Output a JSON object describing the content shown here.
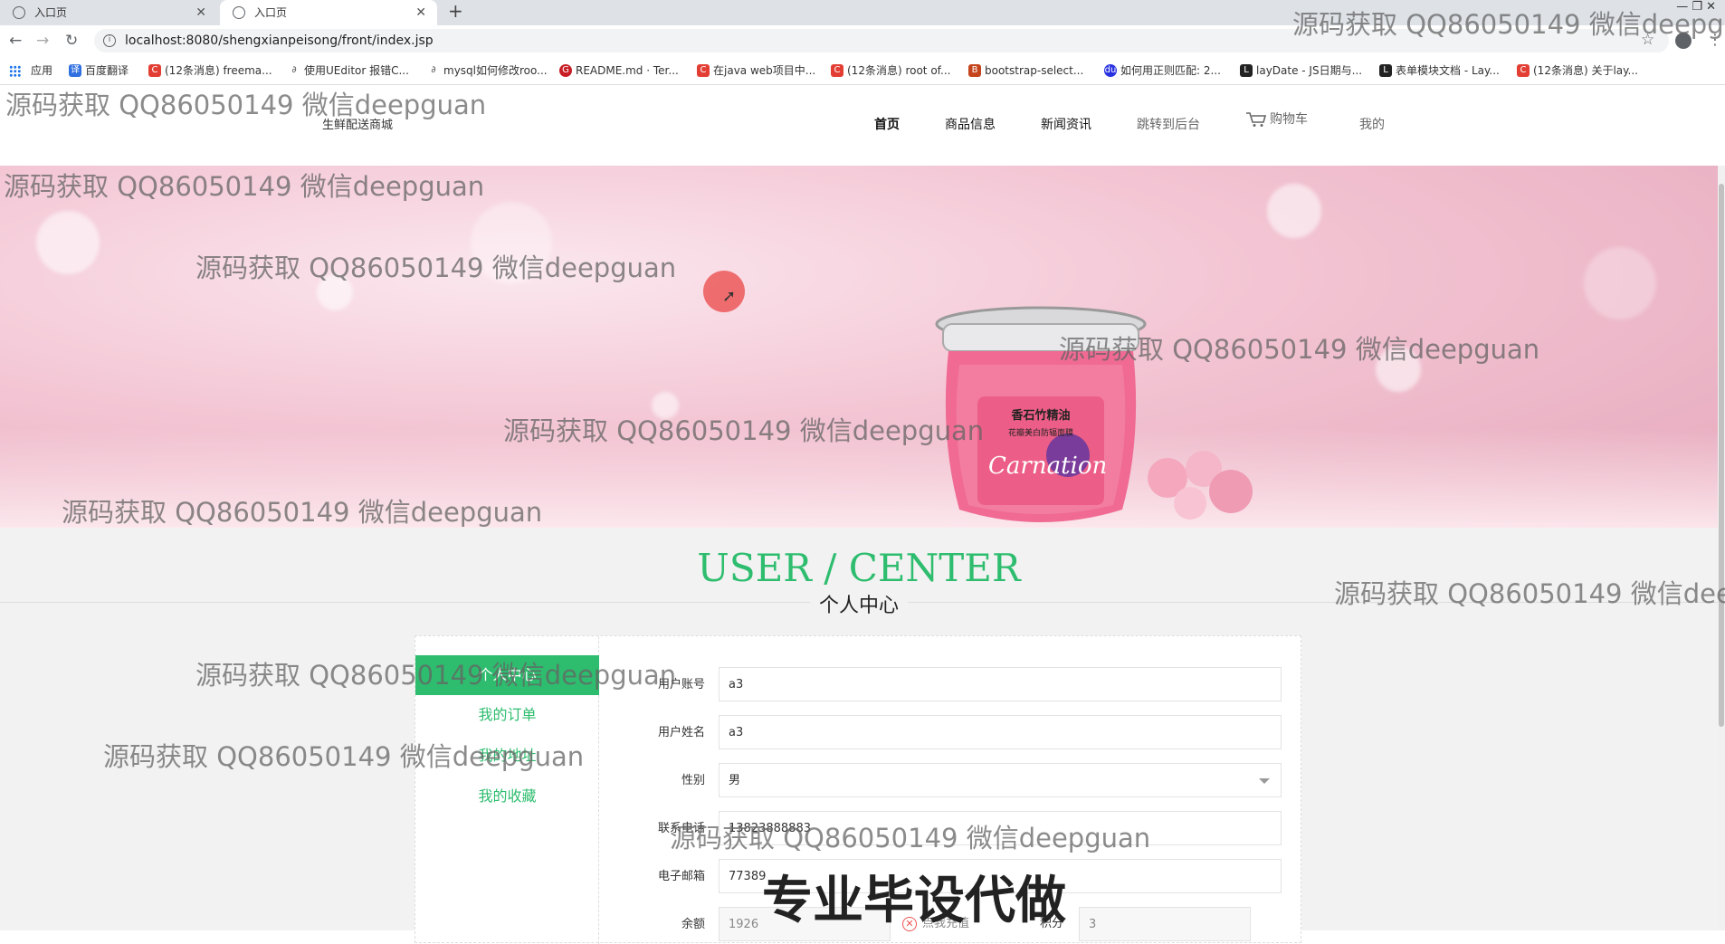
{
  "browser": {
    "tabs": [
      {
        "title": "入口页"
      },
      {
        "title": "入口页"
      }
    ],
    "new_tab": "+",
    "url": "localhost:8080/shengxianpeisong/front/index.jsp",
    "bookmarks": [
      {
        "label": "应用",
        "icon": "apps-grid-icon",
        "color": "#1a73e8"
      },
      {
        "label": "百度翻译",
        "icon": "baidu-translate-icon",
        "color": "#2f6fe0"
      },
      {
        "label": "(12条消息) freema...",
        "icon": "csdn-icon",
        "color": "#e33e33"
      },
      {
        "label": "使用UEditor 报错C...",
        "icon": "link-icon",
        "color": "#555"
      },
      {
        "label": "mysql如何修改roo...",
        "icon": "link-icon",
        "color": "#555"
      },
      {
        "label": "README.md · Ter...",
        "icon": "gitee-icon",
        "color": "#c71d23"
      },
      {
        "label": "在java web项目中...",
        "icon": "csdn-icon",
        "color": "#e33e33"
      },
      {
        "label": "(12条消息) root of...",
        "icon": "csdn-icon",
        "color": "#e33e33"
      },
      {
        "label": "bootstrap-select...",
        "icon": "bootstrap-icon",
        "color": "#c4441c"
      },
      {
        "label": "如何用正则匹配: 2...",
        "icon": "baidu-icon",
        "color": "#2932e1"
      },
      {
        "label": "layDate - JS日期与...",
        "icon": "layui-icon",
        "color": "#222"
      },
      {
        "label": "表单模块文档 - Lay...",
        "icon": "layui-icon",
        "color": "#222"
      },
      {
        "label": "(12条消息) 关于lay...",
        "icon": "csdn-icon",
        "color": "#e33e33"
      }
    ]
  },
  "site": {
    "logo": "生鲜配送商城",
    "nav": [
      "首页",
      "商品信息",
      "新闻资讯",
      "跳转到后台",
      "购物车",
      "我的"
    ]
  },
  "user_center": {
    "title": "USER / CENTER",
    "subtitle": "个人中心",
    "sidebar": [
      "个人中心",
      "我的订单",
      "我的地址",
      "我的收藏"
    ],
    "form": {
      "account_label": "用户账号",
      "account_value": "a3",
      "name_label": "用户姓名",
      "name_value": "a3",
      "gender_label": "性别",
      "gender_value": "男",
      "phone_label": "联系电话",
      "phone_value": "13823888883",
      "email_label": "电子邮箱",
      "email_value": "77389",
      "balance_label": "余额",
      "balance_value": "1926",
      "recharge_label": "点我充值",
      "points_label": "积分",
      "points_value": "3"
    }
  },
  "banner": {
    "product_name": "香石竹精油",
    "product_desc": "花瓣美白防辐面膜",
    "product_brand": "Carnation"
  },
  "watermarks": {
    "text": "源码获取 QQ86050149 微信deepguan",
    "big": "专业毕设代做"
  },
  "colors": {
    "accent_green": "#2ebd6e",
    "banner_pink": "#f3c4d3"
  }
}
